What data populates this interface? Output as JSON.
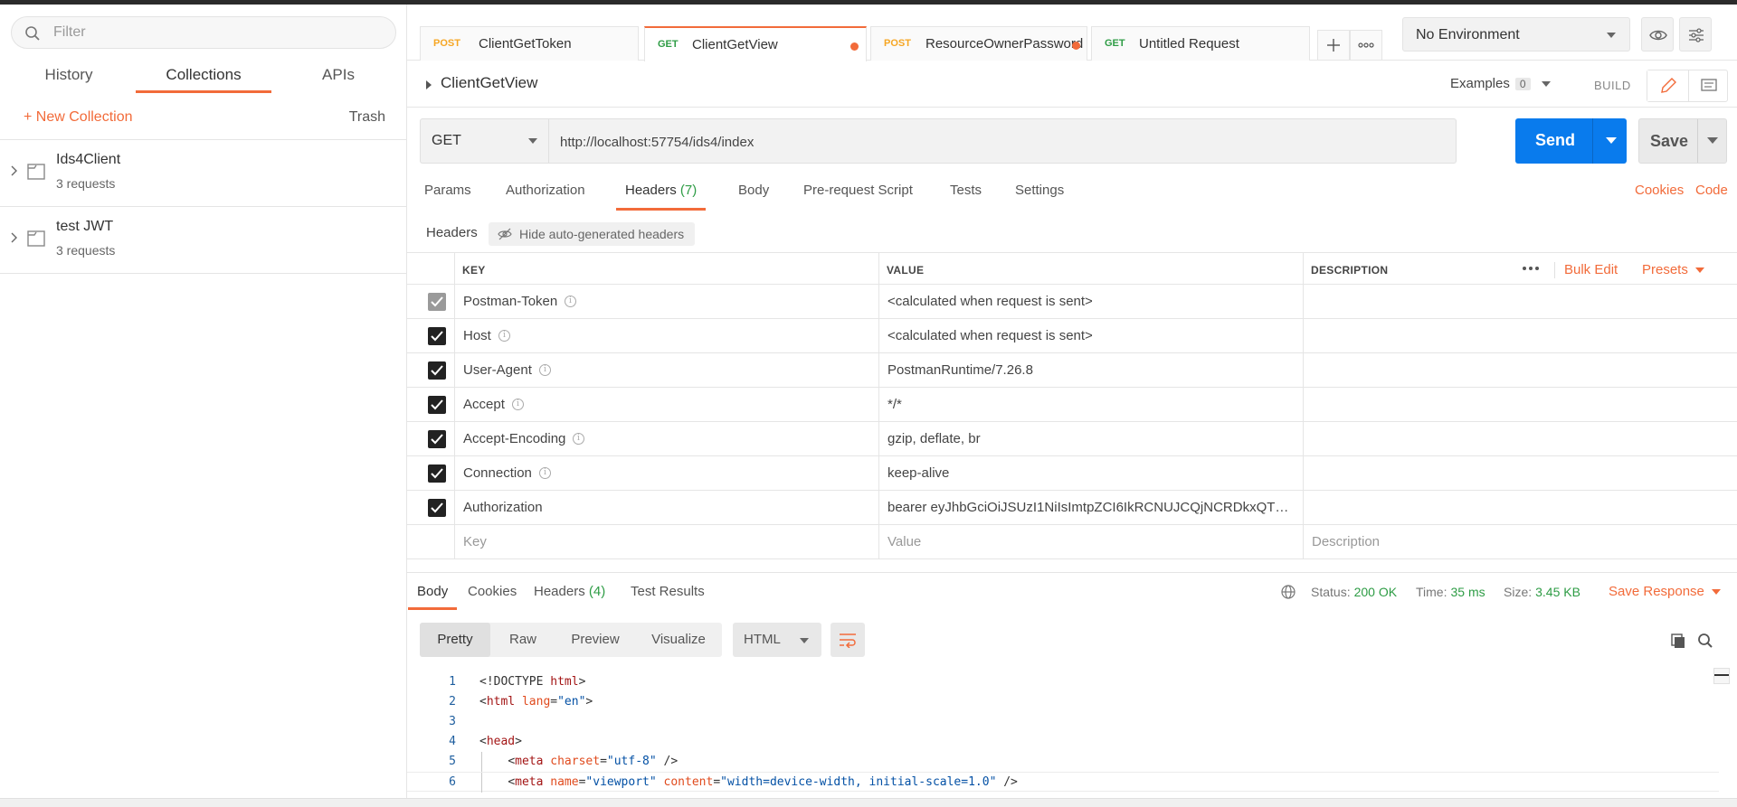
{
  "sidebar": {
    "filter_placeholder": "Filter",
    "tabs": [
      "History",
      "Collections",
      "APIs"
    ],
    "active_tab": "Collections",
    "new_collection": "+ New Collection",
    "trash": "Trash",
    "collections": [
      {
        "name": "Ids4Client",
        "count": "3 requests"
      },
      {
        "name": "test JWT",
        "count": "3 requests"
      }
    ]
  },
  "tabs": [
    {
      "method": "POST",
      "name": "ClientGetToken",
      "unsaved": false
    },
    {
      "method": "GET",
      "name": "ClientGetView",
      "unsaved": true,
      "active": true
    },
    {
      "method": "POST",
      "name": "ResourceOwnerPassword",
      "unsaved": true
    },
    {
      "method": "GET",
      "name": "Untitled Request",
      "unsaved": false
    }
  ],
  "environment": "No Environment",
  "request": {
    "name": "ClientGetView",
    "examples_label": "Examples",
    "examples_count": "0",
    "build_label": "BUILD",
    "method": "GET",
    "url": "http://localhost:57754/ids4/index",
    "send_label": "Send",
    "save_label": "Save"
  },
  "request_tabs": {
    "params": "Params",
    "authorization": "Authorization",
    "headers": "Headers",
    "headers_count": "(7)",
    "body": "Body",
    "prerequest": "Pre-request Script",
    "tests": "Tests",
    "settings": "Settings",
    "cookies": "Cookies",
    "code": "Code"
  },
  "headers_section": {
    "label": "Headers",
    "hide_auto": "Hide auto-generated headers",
    "columns": {
      "key": "KEY",
      "value": "VALUE",
      "description": "DESCRIPTION"
    },
    "bulk_edit": "Bulk Edit",
    "presets": "Presets",
    "rows": [
      {
        "key": "Postman-Token",
        "value": "<calculated when request is sent>",
        "info": true,
        "disabled": true
      },
      {
        "key": "Host",
        "value": "<calculated when request is sent>",
        "info": true,
        "disabled": false
      },
      {
        "key": "User-Agent",
        "value": "PostmanRuntime/7.26.8",
        "info": true,
        "disabled": false
      },
      {
        "key": "Accept",
        "value": "*/*",
        "info": true,
        "disabled": false
      },
      {
        "key": "Accept-Encoding",
        "value": "gzip, deflate, br",
        "info": true,
        "disabled": false
      },
      {
        "key": "Connection",
        "value": "keep-alive",
        "info": true,
        "disabled": false
      },
      {
        "key": "Authorization",
        "value": "bearer eyJhbGciOiJSUzI1NiIsImtpZCI6IkRCNUJCQjNCRDkxQTZG...",
        "info": false,
        "disabled": false
      }
    ],
    "placeholder": {
      "key": "Key",
      "value": "Value",
      "description": "Description"
    }
  },
  "response": {
    "tabs": {
      "body": "Body",
      "cookies": "Cookies",
      "headers": "Headers",
      "headers_count": "(4)",
      "test_results": "Test Results"
    },
    "status_label": "Status:",
    "status_value": "200 OK",
    "time_label": "Time:",
    "time_value": "35 ms",
    "size_label": "Size:",
    "size_value": "3.45 KB",
    "save_response": "Save Response",
    "view_modes": [
      "Pretty",
      "Raw",
      "Preview",
      "Visualize"
    ],
    "active_view": "Pretty",
    "language": "HTML",
    "code_lines": [
      {
        "n": "1",
        "text": "<!DOCTYPE html>"
      },
      {
        "n": "2",
        "text": "<html lang=\"en\">"
      },
      {
        "n": "3",
        "text": ""
      },
      {
        "n": "4",
        "text": "<head>"
      },
      {
        "n": "5",
        "text": "    <meta charset=\"utf-8\" />"
      },
      {
        "n": "6",
        "text": "    <meta name=\"viewport\" content=\"width=device-width, initial-scale=1.0\" />"
      }
    ]
  },
  "colors": {
    "accent": "#f26b3a",
    "send": "#097bed",
    "get": "#2e9c45",
    "post": "#f6a623"
  }
}
